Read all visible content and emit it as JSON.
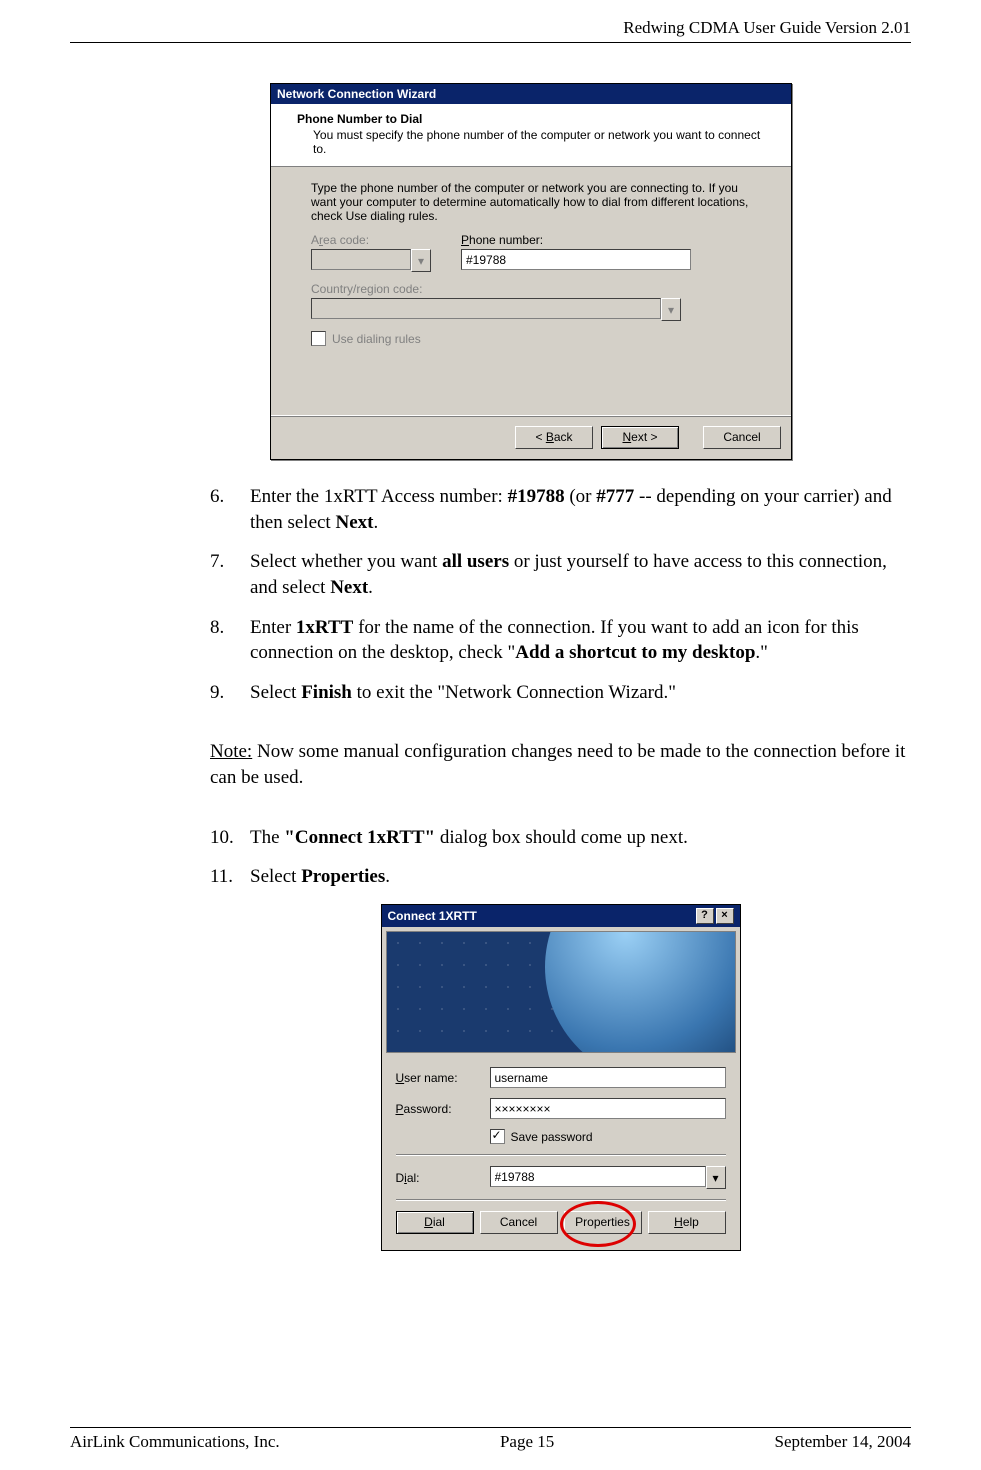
{
  "header": {
    "title": "Redwing CDMA User Guide Version 2.01"
  },
  "footer": {
    "left": "AirLink Communications, Inc.",
    "center": "Page 15",
    "right": "September 14, 2004"
  },
  "wizard": {
    "title": "Network Connection Wizard",
    "heading": "Phone Number to Dial",
    "subheading": "You must specify the phone number of the computer or network you want to connect to.",
    "instruction": "Type the phone number of the computer or network you are connecting to. If you want your computer to determine automatically how to dial from different locations, check Use dialing rules.",
    "area_code_label_pre": "A",
    "area_code_label_u": "r",
    "area_code_label_post": "ea code:",
    "phone_label_u": "P",
    "phone_label_post": "hone number:",
    "phone_value": "#19788",
    "country_label_pre": "Country/region code:",
    "use_dialing_u": "U",
    "use_dialing_post": "se dialing rules",
    "back_pre": "< ",
    "back_u": "B",
    "back_post": "ack",
    "next_u": "N",
    "next_post": "ext >",
    "cancel": "Cancel"
  },
  "steps": {
    "s6_num": "6.",
    "s6_a": "Enter the 1xRTT Access number: ",
    "s6_b": "#19788",
    "s6_c": " (or ",
    "s6_d": "#777",
    "s6_e": " -- depending on your carrier) and then select ",
    "s6_f": "Next",
    "s6_g": ".",
    "s7_num": "7.",
    "s7_a": "Select whether you want ",
    "s7_b": "all users",
    "s7_c": " or just yourself to have access to this connection, and select ",
    "s7_d": "Next",
    "s7_e": ".",
    "s8_num": "8.",
    "s8_a": "Enter ",
    "s8_b": "1xRTT",
    "s8_c": " for the name of the connection. If you want to add an icon for this connection on the desktop, check \"",
    "s8_d": "Add a shortcut to my desktop",
    "s8_e": ".\"",
    "s9_num": "9.",
    "s9_a": "Select ",
    "s9_b": "Finish",
    "s9_c": " to exit the \"Network Connection Wizard.\"",
    "note_label": "Note:",
    "note_text": " Now some manual configuration changes need to be made to the connection before it can be used.",
    "s10_num": "10.",
    "s10_a": "The ",
    "s10_b": "\"Connect 1xRTT\"",
    "s10_c": " dialog box should come up next.",
    "s11_num": "11.",
    "s11_a": "Select ",
    "s11_b": "Properties",
    "s11_c": "."
  },
  "connect": {
    "title": "Connect 1XRTT",
    "help_icon": "?",
    "close_icon": "×",
    "user_u": "U",
    "user_post": "ser name:",
    "user_value": "username",
    "pass_u": "P",
    "pass_post": "assword:",
    "pass_value": "××××××××",
    "save_u": "S",
    "save_post": "ave password",
    "dial_u": "i",
    "dial_pre": "D",
    "dial_post": "al:",
    "dial_value": "#19788",
    "btn_dial_u": "D",
    "btn_dial_post": "ial",
    "btn_cancel": "Cancel",
    "btn_props": "Properties",
    "btn_help_u": "H",
    "btn_help_post": "elp"
  }
}
